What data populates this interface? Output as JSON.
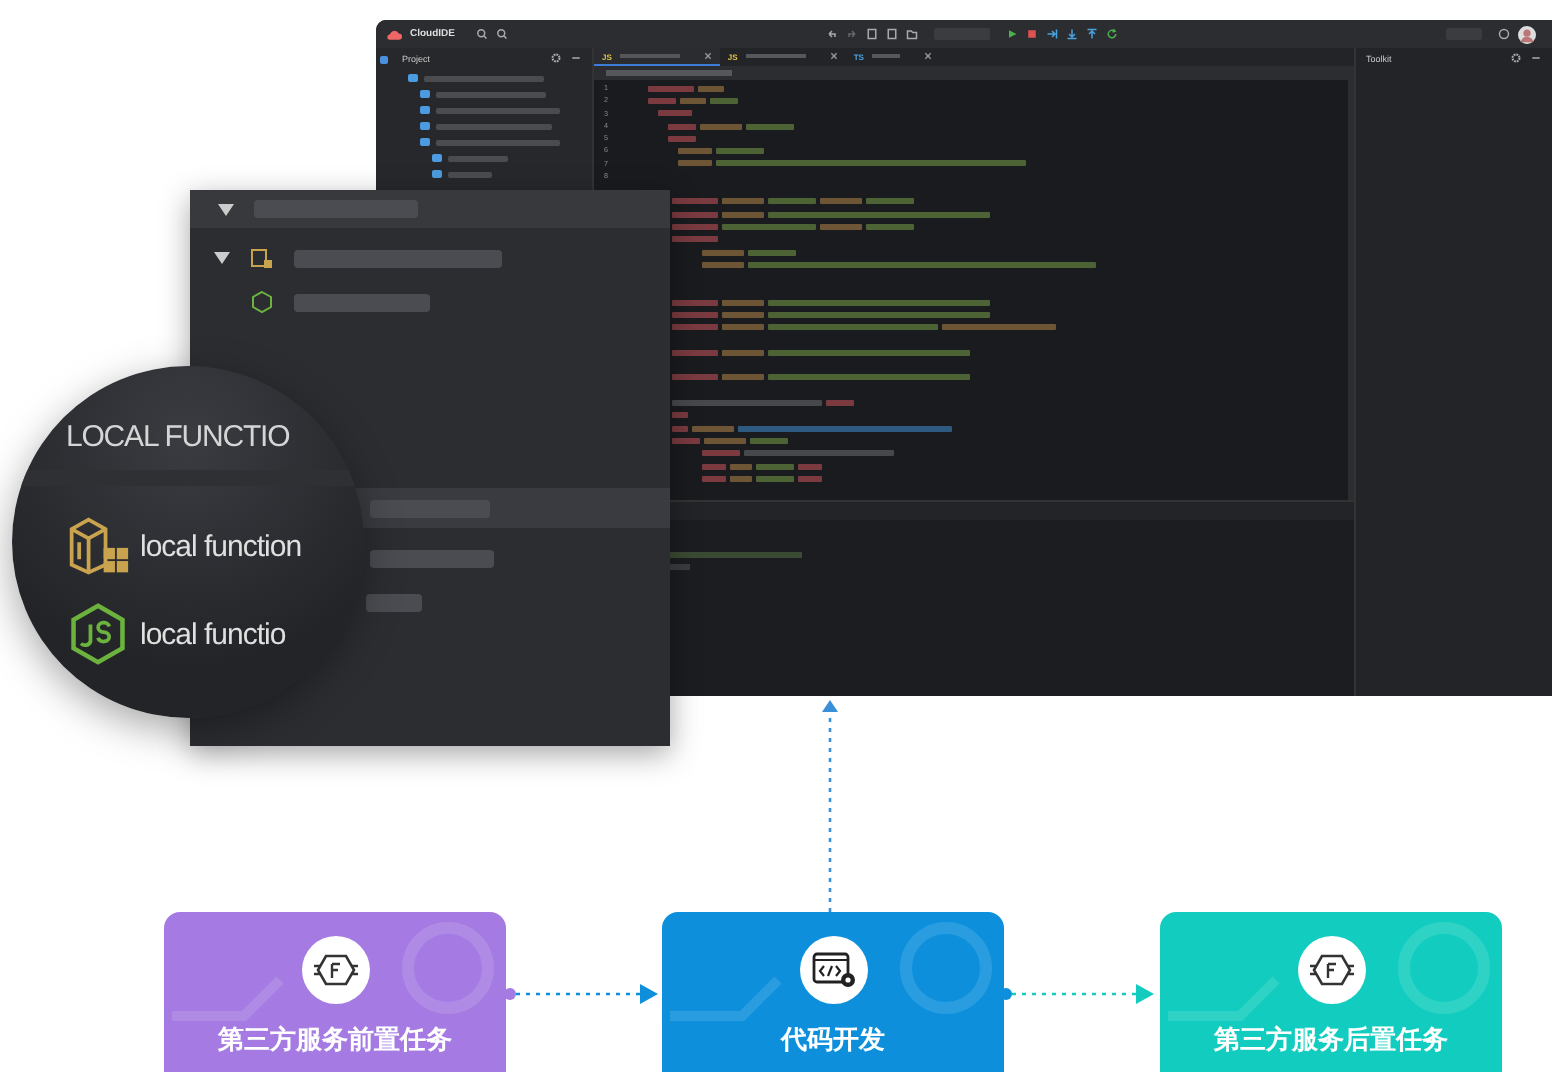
{
  "ide": {
    "app_name": "CloudIDE",
    "explorer_title": "Project",
    "toolkit_title": "Toolkit",
    "tabs": [
      {
        "label": "JS",
        "kind": "js",
        "selected": true
      },
      {
        "label": "JS",
        "kind": "js",
        "selected": false
      },
      {
        "label": "TS",
        "kind": "ts",
        "selected": false
      }
    ],
    "line_numbers": [
      "1",
      "2",
      "3",
      "4",
      "5",
      "6",
      "7",
      "8"
    ]
  },
  "zoom_lens": {
    "header": "LOCAL FUNCTIO",
    "items": [
      {
        "kind": "package",
        "label": "local function"
      },
      {
        "kind": "nodejs",
        "label": "local functio"
      }
    ]
  },
  "flow": [
    {
      "kind": "function",
      "label": "第三方服务前置任务",
      "color": "#a57be3"
    },
    {
      "kind": "code",
      "label": "代码开发",
      "color": "#0d8fdc"
    },
    {
      "kind": "function",
      "label": "第三方服务后置任务",
      "color": "#12cdbf"
    }
  ]
}
